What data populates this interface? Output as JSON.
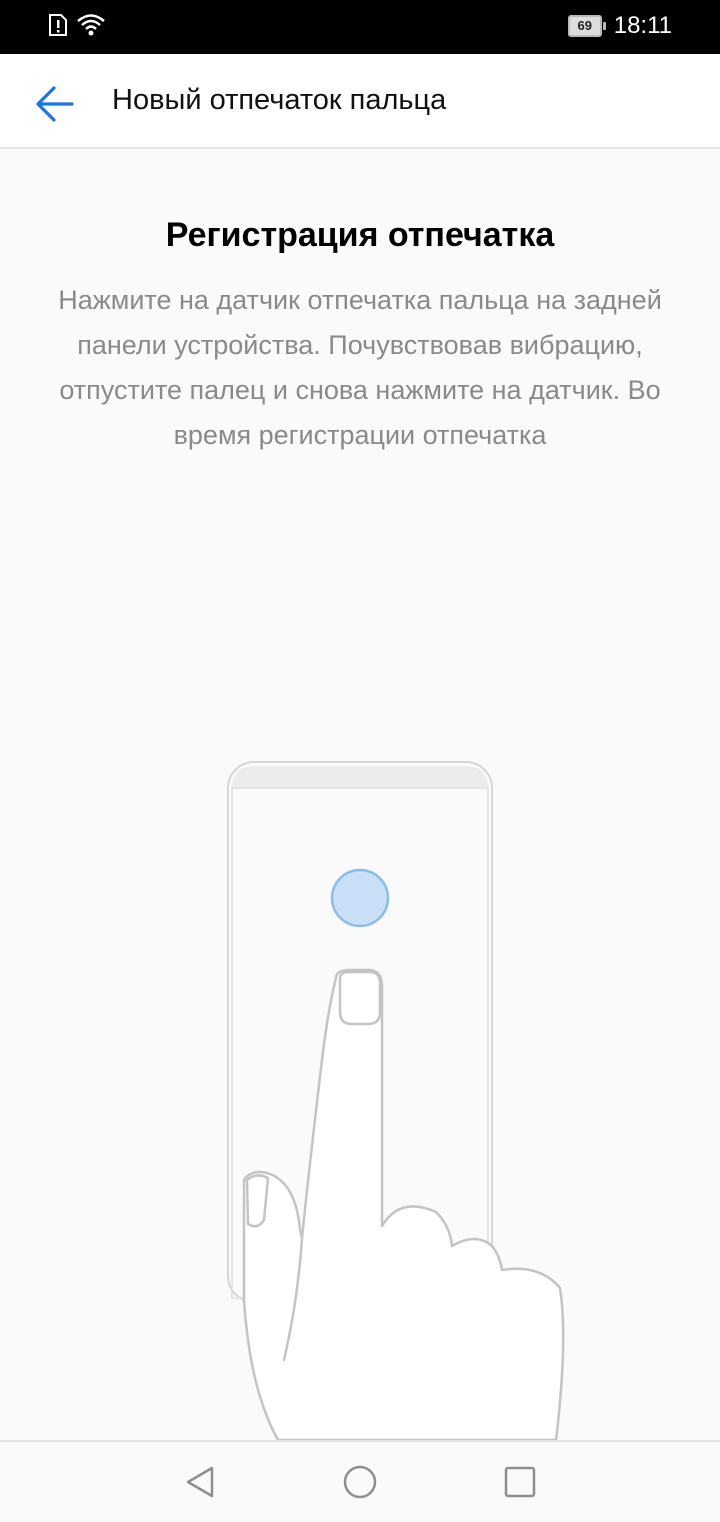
{
  "status_bar": {
    "icons": [
      "sim-alert-icon",
      "wifi-icon"
    ],
    "battery_level": "69",
    "time": "18:11"
  },
  "app_bar": {
    "back_icon": "arrow-left-icon",
    "title": "Новый отпечаток пальца",
    "accent_color": "#1a73e8"
  },
  "content": {
    "title": "Регистрация отпечатка",
    "description": "Нажмите на датчик отпечатка пальца на задней панели устройства. Почувствовав вибрацию, отпустите палец и снова нажмите на датчик. Во время регистрации отпечатка"
  },
  "illustration": {
    "elements": [
      "phone-outline",
      "sensor-dot",
      "pointing-hand"
    ],
    "sensor_color": "#c8dff7"
  },
  "nav_bar": {
    "buttons": [
      "back-triangle-icon",
      "home-circle-icon",
      "recents-square-icon"
    ]
  }
}
